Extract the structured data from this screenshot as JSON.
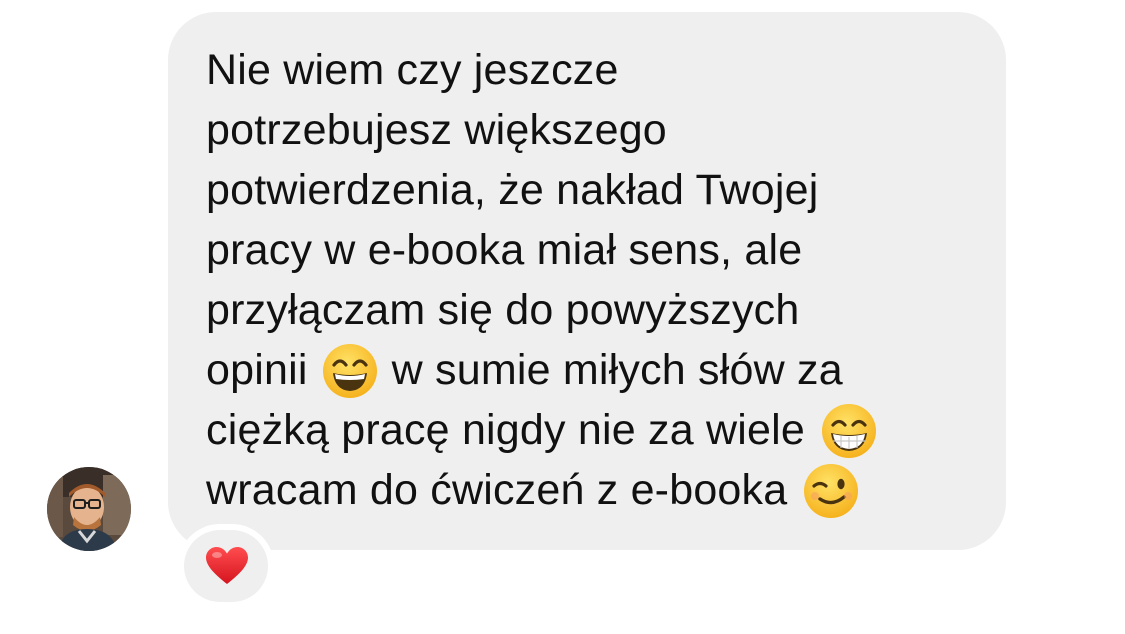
{
  "message": {
    "lines": [
      "Nie wiem czy jeszcze",
      "potrzebujesz większego",
      "potwierdzenia, że nakład Twojej",
      "pracy w e-booka miał sens, ale",
      "przyłączam się do powyższych"
    ],
    "line6_before": "opinii",
    "line6_after": "w sumie miłych słów za",
    "line7": "ciężką pracę nigdy nie za wiele",
    "line8": "wracam do ćwiczeń z e-booka",
    "emoji_1": "grinning-face-with-smiling-eyes",
    "emoji_2": "beaming-face-with-smiling-eyes",
    "emoji_3": "winking-face"
  },
  "reaction": {
    "emoji": "red-heart",
    "color": "#e8202a"
  },
  "sender": {
    "avatar": "profile-photo"
  },
  "colors": {
    "bubble": "#efefef",
    "text": "#111111",
    "background": "#ffffff"
  }
}
